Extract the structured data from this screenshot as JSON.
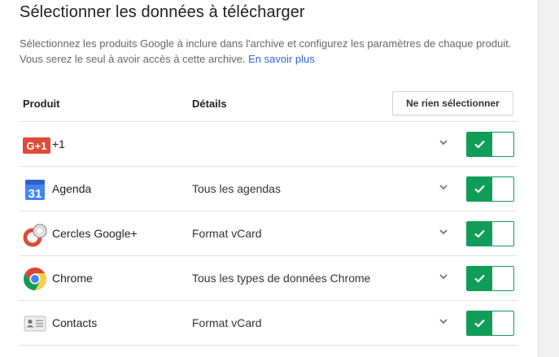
{
  "page": {
    "title": "Sélectionner les données à télécharger",
    "description": "Sélectionnez les produits Google à inclure dans l'archive et configurez les paramètres de chaque produit. Vous serez le seul à avoir accès à cette archive.",
    "learn_more": "En savoir plus"
  },
  "table": {
    "col_product": "Produit",
    "col_details": "Détails",
    "select_none": "Ne rien sélectionner",
    "rows": [
      {
        "icon": "google-plus-one-icon",
        "name": "+1",
        "detail": "",
        "icon_text": "G+1",
        "checked": true
      },
      {
        "icon": "calendar-icon",
        "name": "Agenda",
        "detail": "Tous les agendas",
        "icon_text": "31",
        "checked": true
      },
      {
        "icon": "google-circles-icon",
        "name": "Cercles Google+",
        "detail": "Format vCard",
        "checked": true
      },
      {
        "icon": "chrome-icon",
        "name": "Chrome",
        "detail": "Tous les types de données Chrome",
        "checked": true
      },
      {
        "icon": "contacts-icon",
        "name": "Contacts",
        "detail": "Format vCard",
        "checked": true
      }
    ]
  },
  "colors": {
    "toggle_on": "#0f9d58",
    "link": "#3367d6",
    "gplus_red": "#dd4b39",
    "calendar_blue": "#4285f4"
  }
}
